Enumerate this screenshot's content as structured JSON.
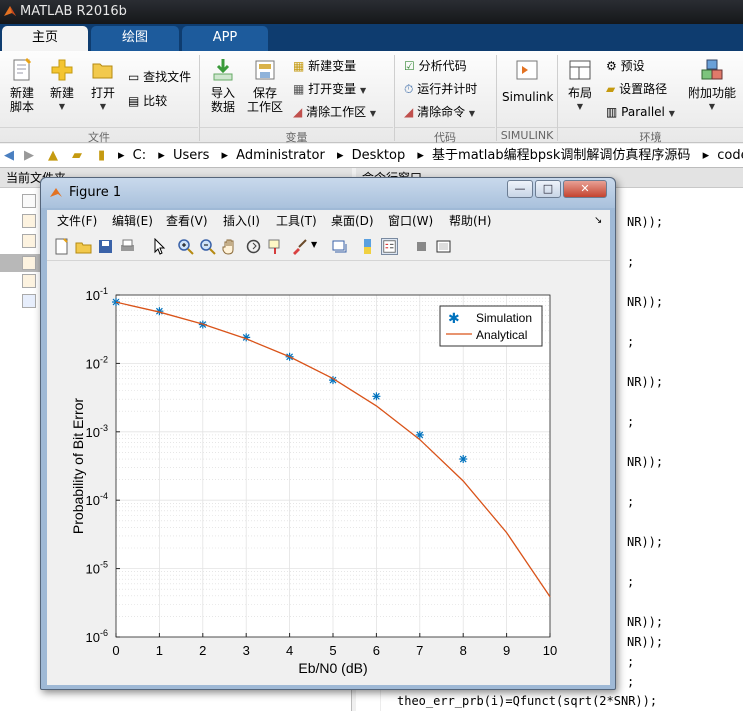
{
  "window": {
    "title": "MATLAB R2016b"
  },
  "tabs": [
    {
      "label": "主页",
      "active": true
    },
    {
      "label": "绘图",
      "active": false
    },
    {
      "label": "APP",
      "active": false
    }
  ],
  "ribbon": {
    "file": {
      "title": "文件",
      "new_script": [
        "新建",
        "脚本"
      ],
      "new": "新建",
      "open": "打开",
      "find_files": "查找文件",
      "compare": "比较"
    },
    "variable": {
      "title": "变量",
      "import": [
        "导入",
        "数据"
      ],
      "save_ws": [
        "保存",
        "工作区"
      ],
      "new_var": "新建变量",
      "open_var": "打开变量",
      "clear_ws": "清除工作区"
    },
    "code": {
      "title": "代码",
      "analyze": "分析代码",
      "run_time": "运行并计时",
      "clear_cmd": "清除命令"
    },
    "simulink": {
      "title": "SIMULINK",
      "label": "Simulink"
    },
    "env": {
      "title": "环境",
      "layout": "布局",
      "prefs": "预设",
      "set_path": "设置路径",
      "parallel": "Parallel",
      "addons": "附加功能"
    }
  },
  "address": {
    "segments": [
      "C:",
      "Users",
      "Administrator",
      "Desktop",
      "基于matlab编程bpsk调制解调仿真程序源码",
      "code"
    ]
  },
  "left_panel": {
    "title": "当前文件夹"
  },
  "right_panel": {
    "title": "命令行窗口",
    "lines": [
      "NR));",
      ";",
      "NR));",
      ";",
      "NR));",
      ";",
      "NR));",
      ";",
      "NR));",
      ";",
      "NR));",
      ";",
      "NR));",
      ";"
    ],
    "last_line": "theo_err_prb(i)=Qfunct(sqrt(2*SNR));"
  },
  "figure": {
    "title": "Figure 1",
    "menu": [
      "文件(F)",
      "编辑(E)",
      "查看(V)",
      "插入(I)",
      "工具(T)",
      "桌面(D)",
      "窗口(W)",
      "帮助(H)"
    ],
    "controls": {
      "minimize": "—",
      "maximize": "□",
      "close": "✕"
    }
  },
  "chart_data": {
    "type": "line",
    "xlabel": "Eb/N0 (dB)",
    "ylabel": "Probability of Bit Error",
    "xlim": [
      0,
      10
    ],
    "ylim": [
      1e-06,
      0.1
    ],
    "yscale": "log",
    "grid": true,
    "minor_grid": true,
    "legend_position": "top-right",
    "xticks": [
      0,
      1,
      2,
      3,
      4,
      5,
      6,
      7,
      8,
      9,
      10
    ],
    "yticks": [
      {
        "value": 0.1,
        "base": "10",
        "exp": "-1"
      },
      {
        "value": 0.01,
        "base": "10",
        "exp": "-2"
      },
      {
        "value": 0.001,
        "base": "10",
        "exp": "-3"
      },
      {
        "value": 0.0001,
        "base": "10",
        "exp": "-4"
      },
      {
        "value": 1e-05,
        "base": "10",
        "exp": "-5"
      },
      {
        "value": 1e-06,
        "base": "10",
        "exp": "-6"
      }
    ],
    "series": [
      {
        "name": "Simulation",
        "marker": "*",
        "color": "#0072bd",
        "x": [
          0,
          1,
          2,
          3,
          4,
          5,
          6,
          7,
          8
        ],
        "y": [
          0.079,
          0.058,
          0.037,
          0.024,
          0.0125,
          0.0057,
          0.0033,
          0.0009,
          0.0004
        ]
      },
      {
        "name": "Analytical",
        "marker": "none",
        "color": "#d95319",
        "x": [
          0,
          1,
          2,
          3,
          4,
          5,
          6,
          7,
          8,
          9,
          10
        ],
        "y": [
          0.0786,
          0.0563,
          0.0375,
          0.0229,
          0.0125,
          0.006,
          0.00239,
          0.00077,
          0.000191,
          3.36e-05,
          3.87e-06
        ]
      }
    ]
  }
}
